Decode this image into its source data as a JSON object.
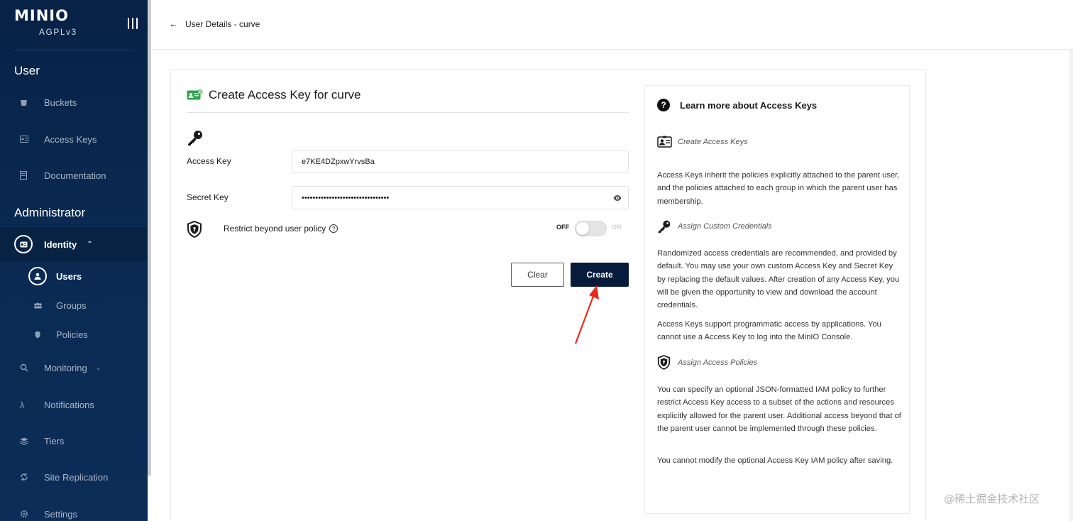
{
  "sidebar": {
    "logo": "MINIO",
    "license": "AGPLv3",
    "user_section": "User",
    "user_items": [
      {
        "label": "Buckets",
        "icon": "bucket-icon"
      },
      {
        "label": "Access Keys",
        "icon": "key-card-icon"
      },
      {
        "label": "Documentation",
        "icon": "document-icon"
      }
    ],
    "admin_section": "Administrator",
    "identity": {
      "label": "Identity",
      "expanded": true
    },
    "identity_sub": [
      {
        "label": "Users",
        "icon": "user-icon",
        "active": true
      },
      {
        "label": "Groups",
        "icon": "group-icon"
      },
      {
        "label": "Policies",
        "icon": "policy-icon"
      }
    ],
    "admin_items": [
      {
        "label": "Monitoring",
        "icon": "monitoring-icon"
      },
      {
        "label": "Notifications",
        "icon": "lambda-icon"
      },
      {
        "label": "Tiers",
        "icon": "tiers-icon"
      },
      {
        "label": "Site Replication",
        "icon": "replication-icon"
      },
      {
        "label": "Settings",
        "icon": "gear-icon"
      }
    ]
  },
  "header": {
    "back_label": "User Details - curve"
  },
  "form": {
    "title": "Create Access Key for curve",
    "access_key_label": "Access Key",
    "access_key_value": "e7KE4DZpxwYrvsBa",
    "secret_key_label": "Secret Key",
    "secret_key_value": "••••••••••••••••••••••••••••••••",
    "restrict_label": "Restrict beyond user policy",
    "toggle_off": "OFF",
    "toggle_on": "ON",
    "toggle_state": false,
    "clear_label": "Clear",
    "create_label": "Create"
  },
  "help": {
    "title": "Learn more about Access Keys",
    "sections": [
      {
        "heading": "Create Access Keys",
        "paragraphs": [
          "Access Keys inherit the policies explicitly attached to the parent user, and the policies attached to each group in which the parent user has membership."
        ]
      },
      {
        "heading": "Assign Custom Credentials",
        "paragraphs": [
          "Randomized access credentials are recommended, and provided by default. You may use your own custom Access Key and Secret Key by replacing the default values. After creation of any Access Key, you will be given the opportunity to view and download the account credentials.",
          "Access Keys support programmatic access by applications. You cannot use a Access Key to log into the MinIO Console."
        ]
      },
      {
        "heading": "Assign Access Policies",
        "paragraphs": [
          "You can specify an optional JSON-formatted IAM policy to further restrict Access Key access to a subset of the actions and resources explicitly allowed for the parent user. Additional access beyond that of the parent user cannot be implemented through these policies.",
          "You cannot modify the optional Access Key IAM policy after saving."
        ]
      }
    ]
  },
  "watermark": "@稀土掘金技术社区",
  "colors": {
    "sidebar_bg": "#0a2a52",
    "primary_button": "#071b3b",
    "annotation_arrow": "#e8291c"
  }
}
